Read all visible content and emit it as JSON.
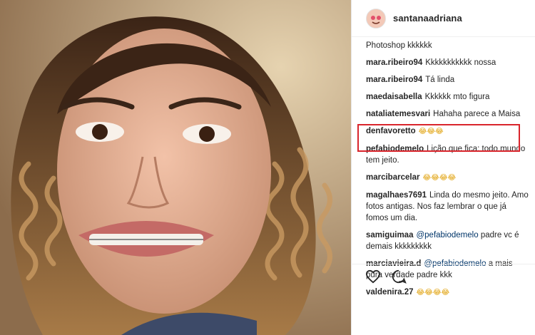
{
  "post": {
    "username": "santanaadriana"
  },
  "comments": [
    {
      "user": "",
      "text": "Photoshop kkkkkk"
    },
    {
      "user": "mara.ribeiro94",
      "text": "Kkkkkkkkkkk nossa"
    },
    {
      "user": "mara.ribeiro94",
      "text": "Tá linda"
    },
    {
      "user": "maedaisabella",
      "text": "Kkkkkk mto figura"
    },
    {
      "user": "nataliatemesvari",
      "text": "Hahaha parece a Maisa"
    },
    {
      "user": "denfavoretto",
      "text": "😂😂😂"
    },
    {
      "user": "pefabiodemelo",
      "text": "Lição que fica: todo mundo tem jeito."
    },
    {
      "user": "marcibarcelar",
      "text": "😂😂😂😂"
    },
    {
      "user": "magalhaes7691",
      "text": "Linda do mesmo jeito. Amo fotos antigas. Nos faz lembrar o que já fomos um dia."
    },
    {
      "user": "samiguimaa",
      "mention": "@pefabiodemelo",
      "text": "padre vc é demais kkkkkkkkk"
    },
    {
      "user": "marciavieira.d",
      "mention": "@pefabiodemelo",
      "text": "a mais pura verdade padre kkk"
    },
    {
      "user": "valdenira.27",
      "text": "😂😂😂😂"
    }
  ],
  "highlight": {
    "color": "#d9252c",
    "comment_index": 6
  },
  "icons": [
    "heart-icon",
    "comment-icon"
  ]
}
